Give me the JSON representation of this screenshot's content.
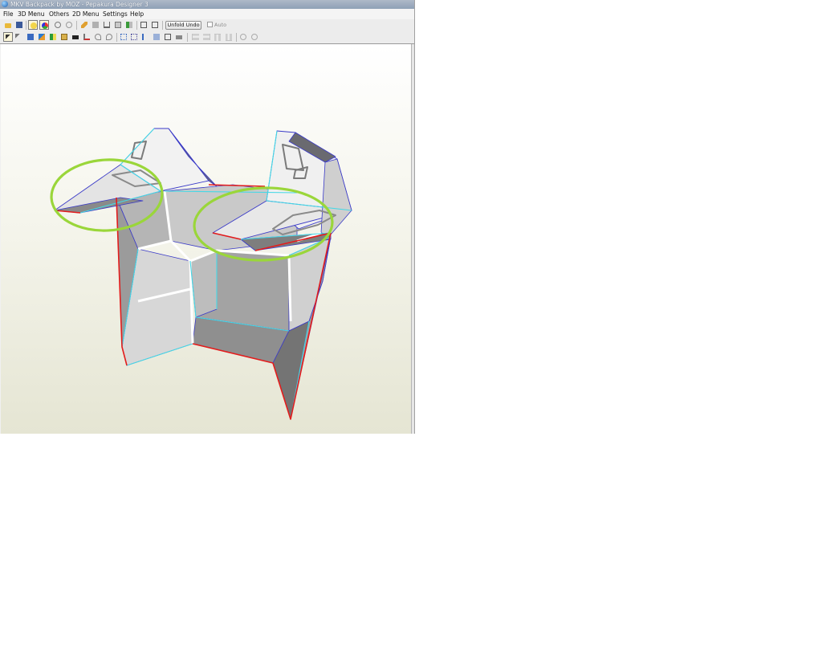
{
  "window": {
    "title": "MKV Backpack by MOZ - Pepakura Designer 3"
  },
  "menu": {
    "items": [
      "File",
      "3D Menu",
      "Others",
      "2D Menu",
      "Settings",
      "Help"
    ]
  },
  "toolbar": {
    "unfold_undo_label": "Unfold Undo",
    "auto_label": "Auto",
    "auto_checked": false
  },
  "annotations": {
    "circle_color": "#9ad63a"
  },
  "colors": {
    "cut_edge": "#e31c1c",
    "fold_edge": "#45d8e6",
    "outline": "#3a3ac8"
  }
}
